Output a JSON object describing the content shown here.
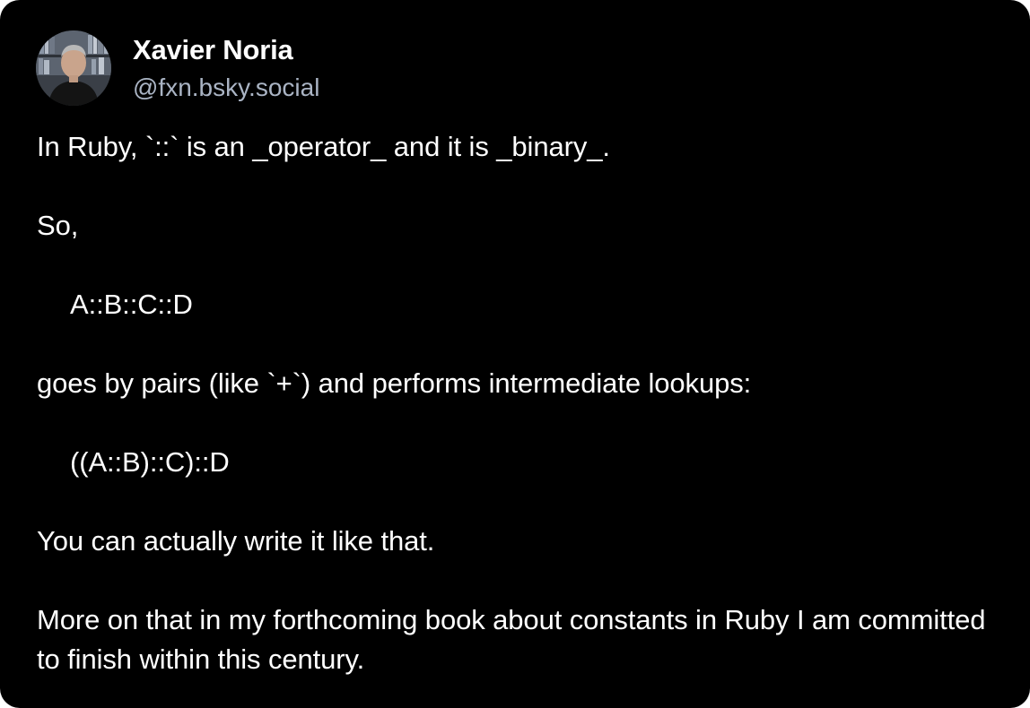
{
  "author": {
    "display_name": "Xavier Noria",
    "handle": "@fxn.bsky.social",
    "avatar_icon": "profile-photo"
  },
  "post": {
    "line1": "In Ruby, `::` is an _operator_ and it is _binary_.",
    "line2": "So,",
    "code1": "A::B::C::D",
    "line3": "goes by pairs (like `+`) and performs intermediate lookups:",
    "code2": "((A::B)::C)::D",
    "line4": "You can actually write it like that.",
    "line5": "More on that in my forthcoming book about constants in Ruby I am committed to finish within this century."
  },
  "colors": {
    "background": "#000000",
    "text": "#ffffff",
    "handle": "#aab4c4"
  }
}
